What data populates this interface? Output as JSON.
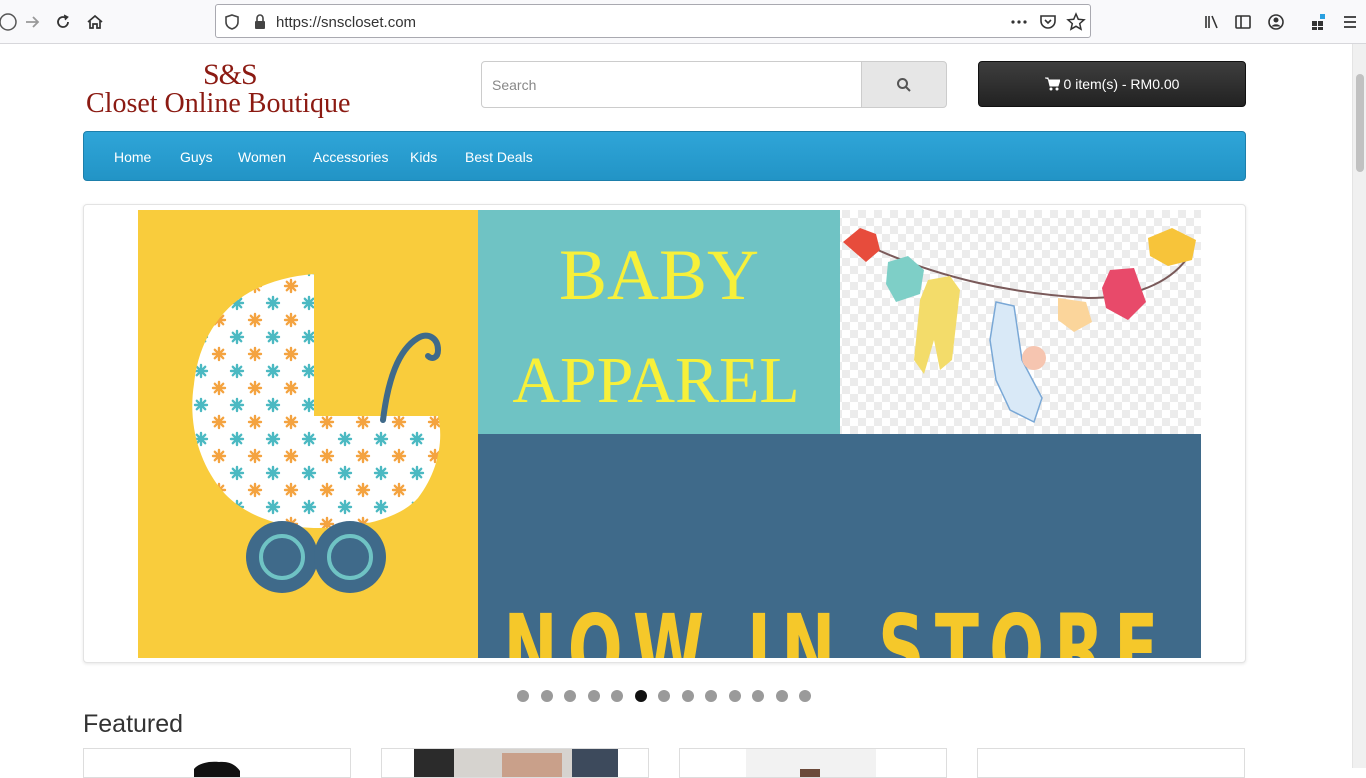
{
  "browser": {
    "url": "https://snscloset.com",
    "icons": [
      "back-icon",
      "forward-icon",
      "reload-icon",
      "home-icon",
      "shield-icon",
      "lock-icon",
      "more-icon",
      "pocket-icon",
      "star-icon",
      "library-icon",
      "sidebar-icon",
      "account-icon",
      "extensions-icon",
      "menu-icon"
    ]
  },
  "header": {
    "logo_top": "S&S",
    "logo_bottom": "Closet Online Boutique",
    "search_placeholder": "Search",
    "cart_label": "0 item(s) - RM0.00"
  },
  "nav": {
    "items": [
      "Home",
      "Guys",
      "Women",
      "Accessories",
      "Kids",
      "Best Deals"
    ]
  },
  "banner": {
    "title_line1": "BABY",
    "title_line2": "APPAREL",
    "subtitle": "NOW IN STORE",
    "colors": {
      "yellow": "#f9cc3c",
      "teal": "#6fc3c4",
      "blue": "#3f6a8a",
      "text_yellow": "#f7f03a",
      "text_gold": "#f5c82a"
    }
  },
  "slider": {
    "dot_count": 13,
    "active_index": 5
  },
  "featured": {
    "heading": "Featured"
  }
}
